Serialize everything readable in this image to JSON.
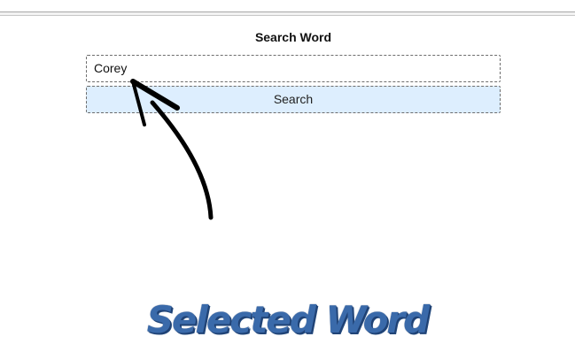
{
  "form": {
    "title": "Search Word",
    "input_value": "Corey",
    "button_label": "Search"
  },
  "annotation": {
    "caption": "Selected Word",
    "caption_color": "#3a6aaa",
    "arrow_icon": "hand-drawn-arrow-icon",
    "arrow_color": "#000000"
  },
  "colors": {
    "button_background": "#ddeefe",
    "border": "#6d6d6d"
  }
}
